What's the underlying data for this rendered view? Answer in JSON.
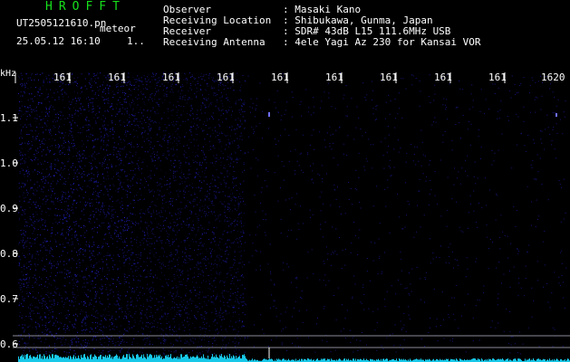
{
  "app": {
    "title": "HROFFT",
    "filename": "UT2505121610.pn",
    "mode": "meteor",
    "datetime": "25.05.12 16:10",
    "mark": "1.."
  },
  "info": [
    {
      "label": "Observer",
      "value": ": Masaki Kano"
    },
    {
      "label": "Receiving Location",
      "value": ": Shibukawa, Gunma, Japan"
    },
    {
      "label": "Receiver",
      "value": ": SDR# 43dB L15 111.6MHz USB"
    },
    {
      "label": "Receiving Antenna",
      "value": ": 4ele Yagi Az 230 for Kansai VOR"
    }
  ],
  "axis": {
    "unit": "kHz",
    "minutes": [
      "161",
      "161",
      "161",
      "161",
      "161",
      "161",
      "161",
      "161",
      "161",
      "1620"
    ],
    "khz": [
      "1.1",
      "1.0",
      "0.9",
      "0.8",
      "0.7",
      "0.6"
    ]
  },
  "colors": {
    "title": "#17e01c",
    "text": "#ffffff",
    "noise": "#2424d8",
    "trace": "#18c8e8"
  }
}
